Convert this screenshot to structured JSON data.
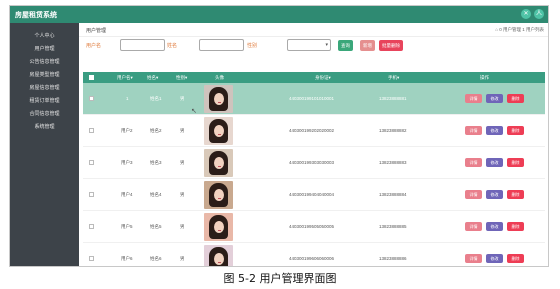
{
  "app": {
    "title": "房屋租赁系统",
    "icon_left": "✕",
    "icon_right": "人"
  },
  "sidebar": {
    "items": [
      "个人中心",
      "用户管理",
      "公告信息管理",
      "房屋类型管理",
      "房屋信息管理",
      "租赁订单管理",
      "合同信息管理",
      "系统管理"
    ]
  },
  "page": {
    "title": "用户管理",
    "breadcrumb": "⌂ 0 用户管理 1 用户列表"
  },
  "search": {
    "field1_label": "用户名",
    "field1_value": "",
    "field2_label": "姓名",
    "field2_value": "",
    "field3_label": "性别",
    "field3_value": "",
    "select_chevron": "▾",
    "search_label": "查询",
    "add_label": "新增",
    "delete_label": "批量删除"
  },
  "table": {
    "headers": [
      "用户名▾",
      "姓名▾",
      "性别▾",
      "头像",
      "身份证▾",
      "手机▾",
      "操作"
    ],
    "actions": {
      "detail": "详情",
      "edit": "修改",
      "delete": "删除"
    },
    "rows": [
      {
        "username": "1",
        "name": "姓名1",
        "gender": "男",
        "id_card": "440300199101010001",
        "phone": "13823888881",
        "selected": true
      },
      {
        "username": "用户2",
        "name": "姓名2",
        "gender": "男",
        "id_card": "440300199202020002",
        "phone": "13823888882",
        "selected": false
      },
      {
        "username": "用户3",
        "name": "姓名3",
        "gender": "男",
        "id_card": "440300199303030003",
        "phone": "13823888883",
        "selected": false
      },
      {
        "username": "用户4",
        "name": "姓名4",
        "gender": "男",
        "id_card": "440300199404040004",
        "phone": "13823888884",
        "selected": false
      },
      {
        "username": "用户5",
        "name": "姓名5",
        "gender": "男",
        "id_card": "440300199505050005",
        "phone": "13823888885",
        "selected": false
      },
      {
        "username": "用户6",
        "name": "姓名6",
        "gender": "男",
        "id_card": "440300199606060006",
        "phone": "13823888886",
        "selected": false
      }
    ]
  },
  "caption": "图 5-2  用户管理界面图",
  "colors": {
    "topbar": "#2f8a72",
    "sidebar": "#3d4349",
    "header": "#3a9d82",
    "btn_search": "#3aa77a",
    "btn_add": "#e58f8f",
    "btn_delete": "#e8445c",
    "act_detail": "#e97f8c",
    "act_edit": "#6f65b8",
    "act_delete": "#ee3d55"
  }
}
